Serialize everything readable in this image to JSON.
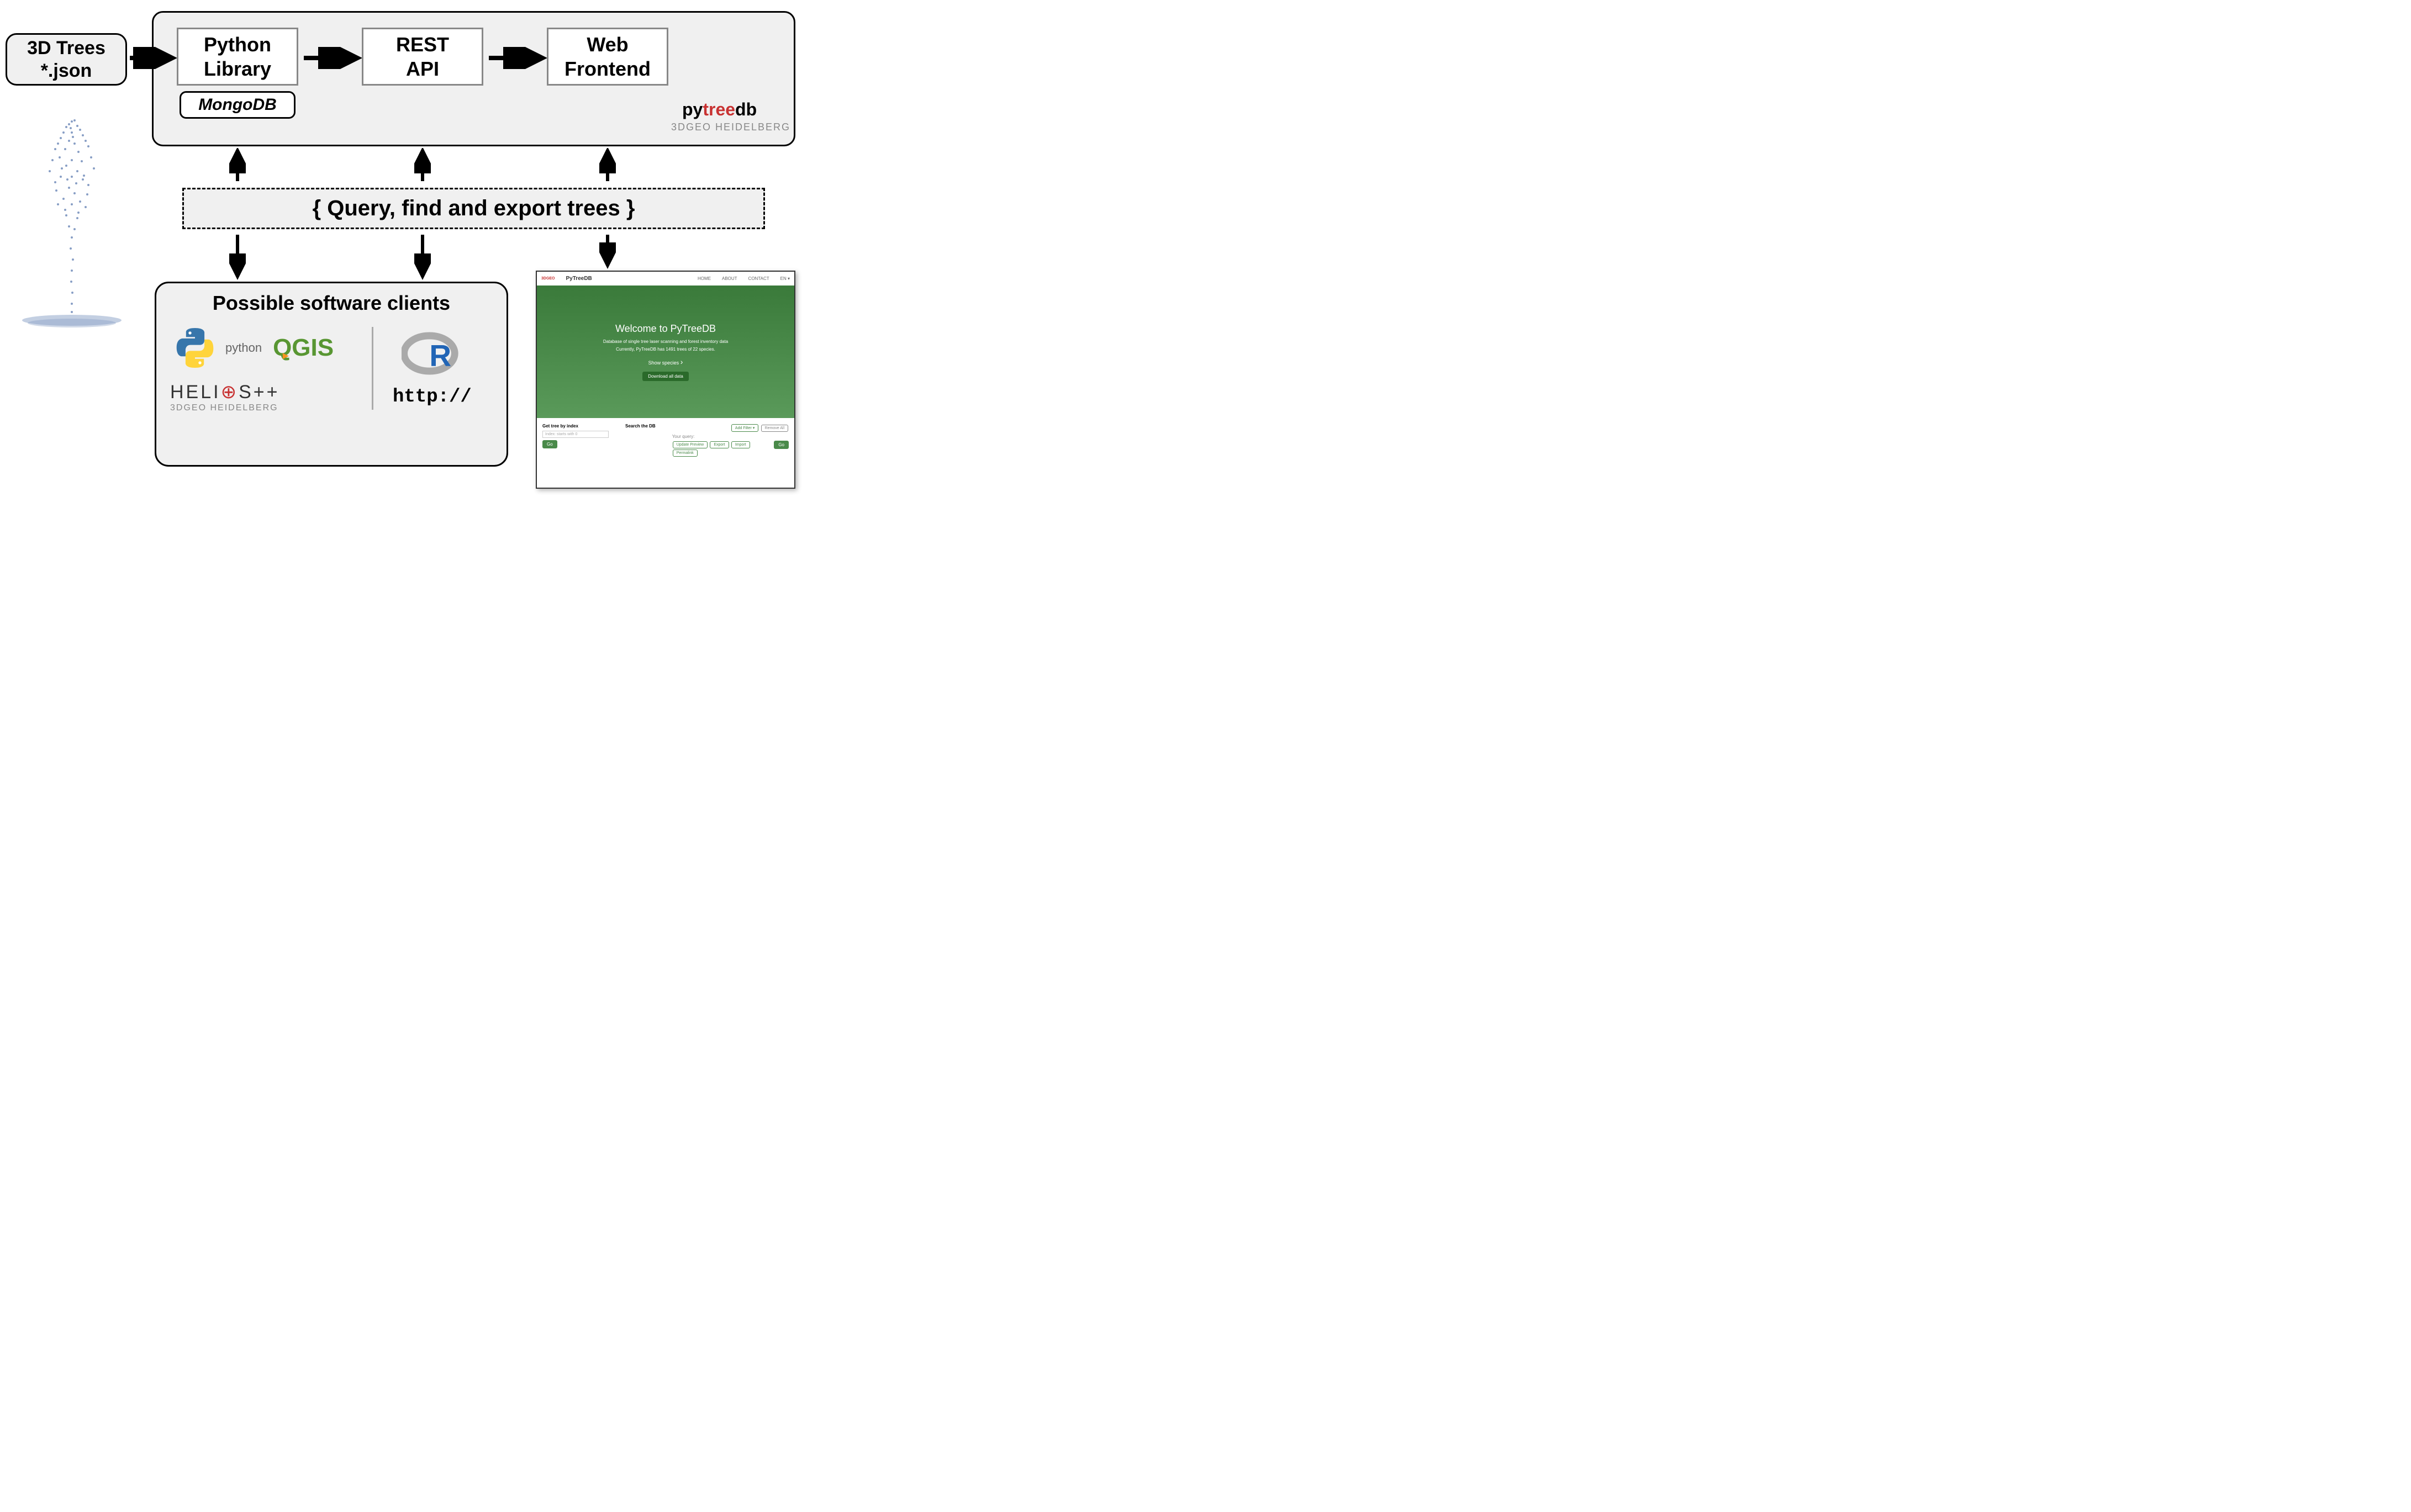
{
  "input_box": {
    "line1": "3D Trees",
    "line2": "*.json"
  },
  "top_container": {
    "python_lib": "Python\nLibrary",
    "mongodb": "MongoDB",
    "rest_api": "REST\nAPI",
    "web_frontend": "Web\nFrontend",
    "brand_py": "py",
    "brand_tree": "tree",
    "brand_db": "db",
    "brand_sub": "3DGEO HEIDELBERG"
  },
  "middle_box": "{ Query, find and export trees }",
  "clients": {
    "title": "Possible software clients",
    "python": "python",
    "qgis": "QGIS",
    "helios": "HELI",
    "helios_suffix": "S++",
    "helios_sub": "3DGEO HEIDELBERG",
    "r": "R",
    "http": "http://"
  },
  "web_preview": {
    "header_brand": "PyTreeDB",
    "nav_home": "HOME",
    "nav_about": "ABOUT",
    "nav_contact": "CONTACT",
    "nav_lang": "EN",
    "hero_title": "Welcome to PyTreeDB",
    "hero_sub1": "Database of single tree laser scanning and forest inventory data",
    "hero_sub2": "Currently, PyTreeDB has 1491 trees of 22 species.",
    "show_species": "Show species",
    "download": "Download all data",
    "footer_get": "Get tree by index",
    "footer_placeholder": "Index: starts with 0",
    "footer_search": "Search the DB",
    "footer_add": "Add Filter",
    "footer_remove": "Remove All",
    "footer_query": "Your query:",
    "footer_update": "Update Preview",
    "footer_export": "Export",
    "footer_import": "Import",
    "footer_permalink": "Permalink",
    "go": "Go"
  }
}
